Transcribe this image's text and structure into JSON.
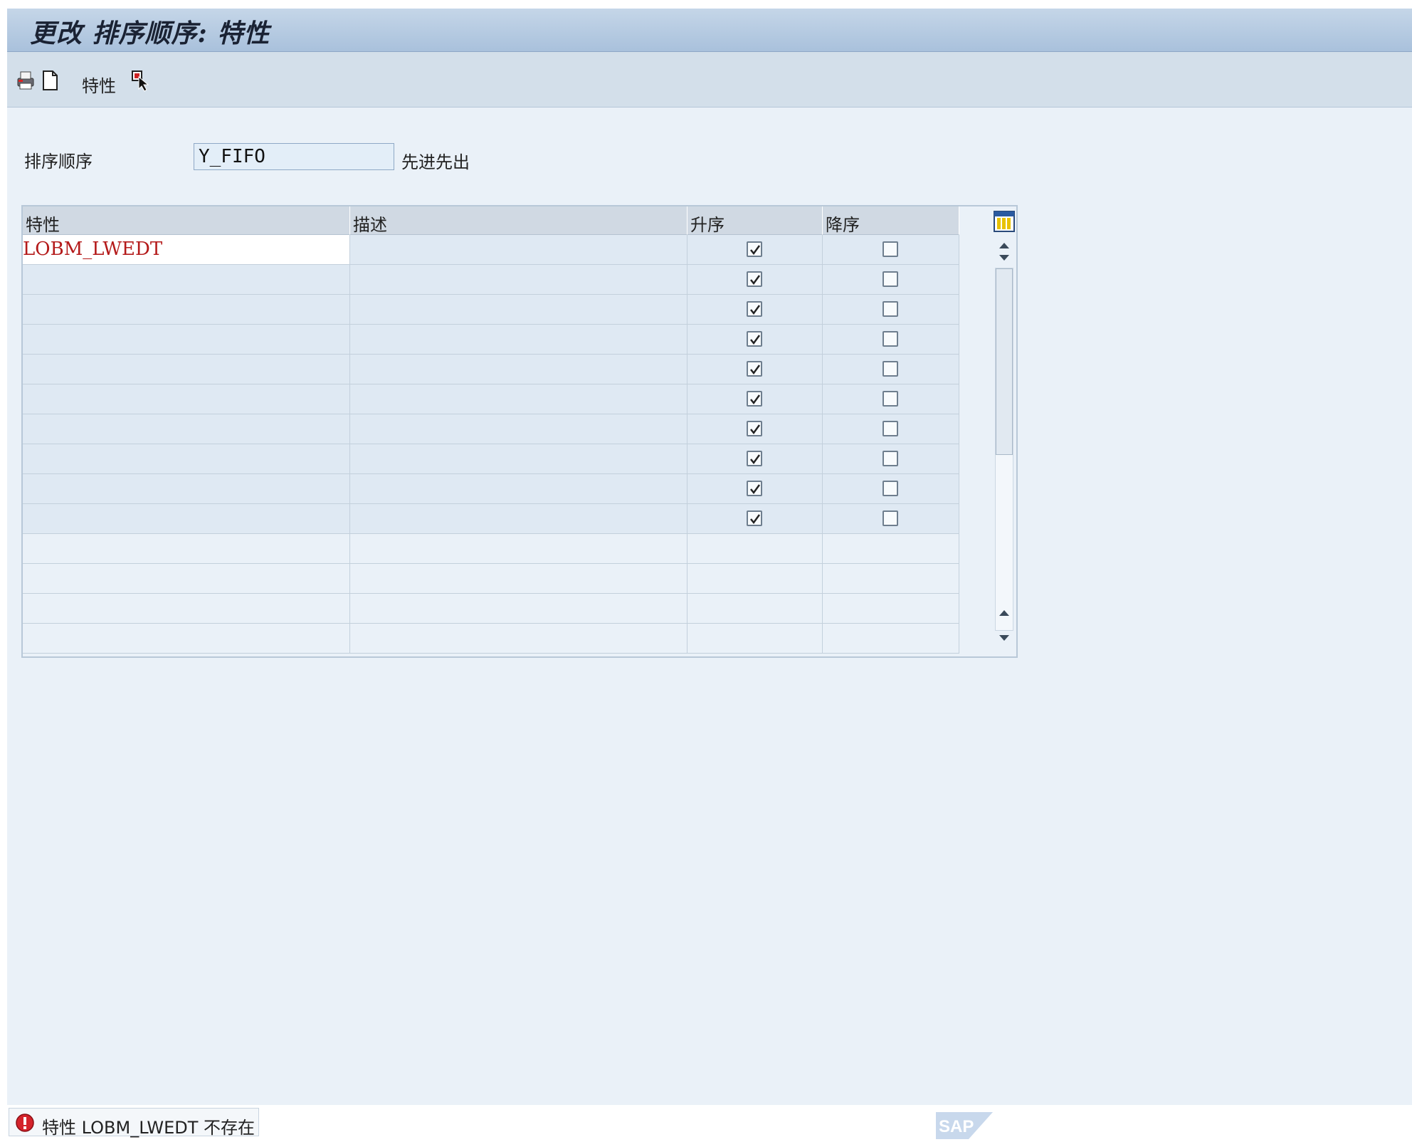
{
  "window": {
    "title": "更改 排序顺序: 特性"
  },
  "toolbar": {
    "text_label": "特性"
  },
  "form": {
    "sort_order_label": "排序顺序",
    "sort_order_value": "Y_FIFO",
    "sort_order_description": "先进先出"
  },
  "table": {
    "headers": [
      "特性",
      "描述",
      "升序",
      "降序"
    ],
    "rows": [
      {
        "characteristic": "LOBM_LWEDT",
        "description": "",
        "ascending": true,
        "descending": false
      },
      {
        "characteristic": "",
        "description": "",
        "ascending": true,
        "descending": false
      },
      {
        "characteristic": "",
        "description": "",
        "ascending": true,
        "descending": false
      },
      {
        "characteristic": "",
        "description": "",
        "ascending": true,
        "descending": false
      },
      {
        "characteristic": "",
        "description": "",
        "ascending": true,
        "descending": false
      },
      {
        "characteristic": "",
        "description": "",
        "ascending": true,
        "descending": false
      },
      {
        "characteristic": "",
        "description": "",
        "ascending": true,
        "descending": false
      },
      {
        "characteristic": "",
        "description": "",
        "ascending": true,
        "descending": false
      },
      {
        "characteristic": "",
        "description": "",
        "ascending": true,
        "descending": false
      },
      {
        "characteristic": "",
        "description": "",
        "ascending": true,
        "descending": false
      }
    ],
    "empty_rows": 4
  },
  "status": {
    "message": "特性 LOBM_LWEDT 不存在",
    "type": "error"
  },
  "icons": {
    "toolbar": [
      "print-icon",
      "new-document-icon",
      "select-cursor-icon"
    ],
    "table": [
      "column-settings-icon",
      "scroll-up-icon",
      "scroll-down-icon"
    ],
    "status": "error-icon",
    "brand": "sap-logo"
  },
  "colors": {
    "error_text": "#b41a1a",
    "title_bar": "#a9c1dc",
    "background": "#eaf1f8"
  }
}
